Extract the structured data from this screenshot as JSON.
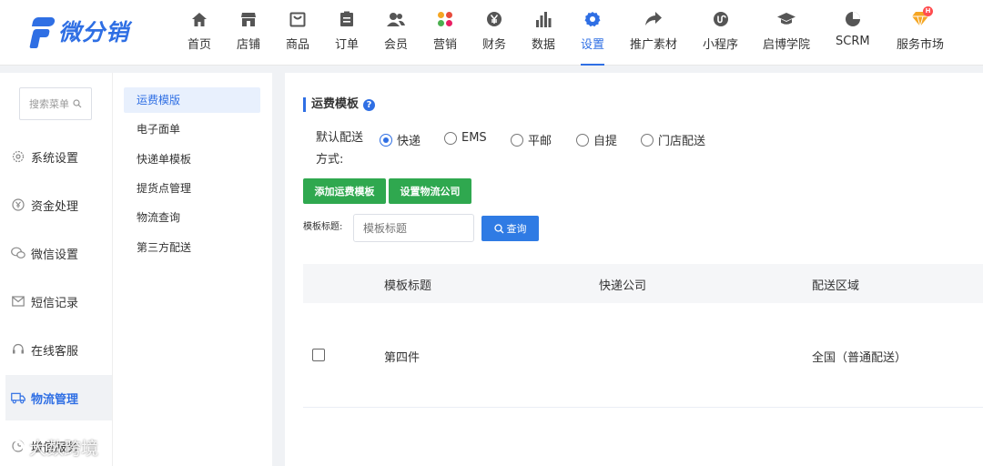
{
  "brand": {
    "name": "微分销",
    "color": "#2f6fe4"
  },
  "nav": {
    "items": [
      {
        "label": "首页",
        "icon": "home-icon"
      },
      {
        "label": "店铺",
        "icon": "store-icon"
      },
      {
        "label": "商品",
        "icon": "product-box-icon"
      },
      {
        "label": "订单",
        "icon": "order-clipboard-icon"
      },
      {
        "label": "会员",
        "icon": "members-icon"
      },
      {
        "label": "营销",
        "icon": "marketing-petals-icon"
      },
      {
        "label": "财务",
        "icon": "finance-yen-icon"
      },
      {
        "label": "数据",
        "icon": "data-bars-icon"
      },
      {
        "label": "设置",
        "icon": "settings-gear-icon",
        "active": true
      },
      {
        "label": "推广素材",
        "icon": "share-arrow-icon"
      },
      {
        "label": "小程序",
        "icon": "mini-program-icon"
      },
      {
        "label": "启博学院",
        "icon": "graduation-cap-icon"
      },
      {
        "label": "SCRM",
        "icon": "pie-chart-icon"
      },
      {
        "label": "服务市场",
        "icon": "diamond-badge-icon",
        "badge": "H"
      }
    ]
  },
  "sidebar": {
    "search_placeholder": "搜索菜单",
    "items": [
      {
        "label": "系统设置",
        "icon": "gear-outline-icon"
      },
      {
        "label": "资金处理",
        "icon": "yen-circle-icon"
      },
      {
        "label": "微信设置",
        "icon": "wechat-icon"
      },
      {
        "label": "短信记录",
        "icon": "envelope-icon"
      },
      {
        "label": "在线客服",
        "icon": "headset-icon"
      },
      {
        "label": "物流管理",
        "icon": "truck-icon",
        "active": true
      },
      {
        "label": "增值服务",
        "icon": "plus-service-icon"
      }
    ]
  },
  "submenu": {
    "items": [
      {
        "label": "运费模版",
        "active": true
      },
      {
        "label": "电子面单"
      },
      {
        "label": "快递单模板"
      },
      {
        "label": "提货点管理"
      },
      {
        "label": "物流查询"
      },
      {
        "label": "第三方配送"
      }
    ]
  },
  "main": {
    "title": "运费模板",
    "help_icon": "?",
    "shipping": {
      "label": "默认配送方式:",
      "options": [
        {
          "label": "快递",
          "checked": true
        },
        {
          "label": "EMS"
        },
        {
          "label": "平邮"
        },
        {
          "label": "自提"
        },
        {
          "label": "门店配送"
        }
      ]
    },
    "buttons": {
      "add_template": "添加运费模板",
      "set_logistics": "设置物流公司"
    },
    "filter": {
      "label": "模板标题:",
      "placeholder": "模板标题",
      "query_button": "查询"
    },
    "table": {
      "headers": [
        "模板标题",
        "快递公司",
        "配送区域"
      ],
      "rows": [
        {
          "title": "第四件",
          "company": "",
          "region": "全国（普通配送）",
          "checked": false
        }
      ]
    }
  },
  "watermark": "大数跨境",
  "colors": {
    "accent": "#2f6fe4",
    "green": "#2fa84f",
    "query_blue": "#2f7be4"
  }
}
